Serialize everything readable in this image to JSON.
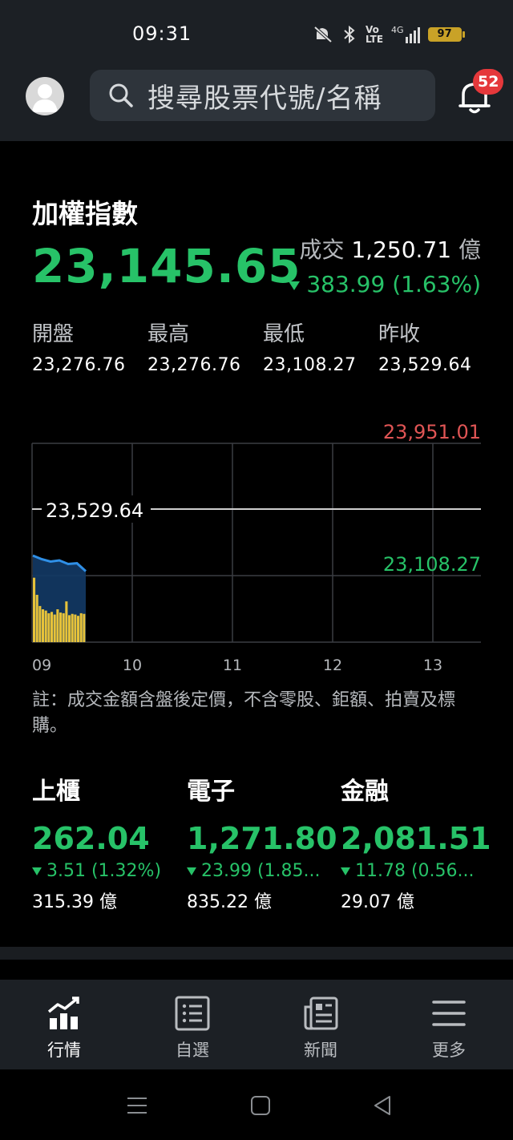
{
  "status": {
    "time": "09:31",
    "battery": "97",
    "network": "4G"
  },
  "header": {
    "search_placeholder": "搜尋股票代號/名稱",
    "notification_count": "52"
  },
  "index": {
    "name": "加權指數",
    "value": "23,145.65",
    "turnover_label": "成交",
    "turnover_value": "1,250.71",
    "turnover_unit": "億",
    "change": "383.99 (1.63%)",
    "color_down": "#27c268",
    "stats": [
      {
        "label": "開盤",
        "value": "23,276.76"
      },
      {
        "label": "最高",
        "value": "23,276.76"
      },
      {
        "label": "最低",
        "value": "23,108.27"
      },
      {
        "label": "昨收",
        "value": "23,529.64"
      }
    ]
  },
  "chart_data": {
    "type": "line",
    "series": [
      {
        "kind": "price_line",
        "x": [
          "09:00",
          "09:05",
          "09:10",
          "09:15",
          "09:20",
          "09:25",
          "09:31"
        ],
        "values": [
          23210,
          23195,
          23185,
          23190,
          23175,
          23178,
          23145
        ]
      }
    ],
    "volume_bars": [
      0.98,
      0.72,
      0.55,
      0.5,
      0.48,
      0.44,
      0.46,
      0.42,
      0.5,
      0.45,
      0.44,
      0.62,
      0.41,
      0.43,
      0.42,
      0.4,
      0.44,
      0.43
    ],
    "reference_label": "23,529.64",
    "reference_value": 23529.64,
    "ylim": [
      22850,
      23951.01
    ],
    "upper_limit_label": "23,951.01",
    "lower_label": "23,108.27",
    "x_ticks": [
      "09",
      "10",
      "11",
      "12",
      "13"
    ],
    "grid": true,
    "colors": {
      "line": "#2f8fe6",
      "fill": "#133a66",
      "volume": "#e6c23a",
      "reference": "#cfcfcf",
      "upper": "#e05555",
      "lower": "#27c268"
    }
  },
  "note": "註：成交金額含盤後定價，不含零股、鉅額、拍賣及標購。",
  "sub_indices": [
    {
      "name": "上櫃",
      "value": "262.04",
      "change": "3.51 (1.32%)",
      "amount": "315.39 億"
    },
    {
      "name": "電子",
      "value": "1,271.80",
      "change": "23.99 (1.85...",
      "amount": "835.22 億"
    },
    {
      "name": "金融",
      "value": "2,081.51",
      "change": "11.78 (0.56...",
      "amount": "29.07 億"
    }
  ],
  "tabs": [
    {
      "label": "行情",
      "icon": "chart-icon",
      "active": true
    },
    {
      "label": "自選",
      "icon": "list-icon",
      "active": false
    },
    {
      "label": "新聞",
      "icon": "news-icon",
      "active": false
    },
    {
      "label": "更多",
      "icon": "menu-icon",
      "active": false
    }
  ]
}
